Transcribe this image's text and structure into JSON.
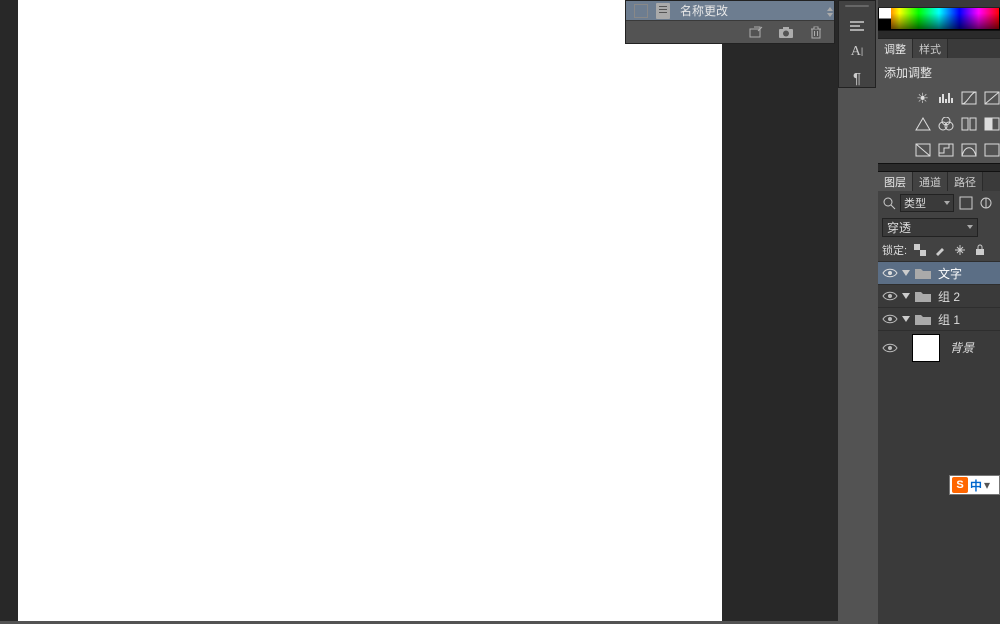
{
  "notes_panel": {
    "filename_label": "名称更改"
  },
  "icon_strip": {
    "lines": "align-lines-icon",
    "type": "A|",
    "paragraph": "¶"
  },
  "adjustments": {
    "tabs": [
      "调整",
      "样式"
    ],
    "title": "添加调整"
  },
  "layers": {
    "tabs": [
      "图层",
      "通道",
      "路径"
    ],
    "filter_label": "类型",
    "blend_mode": "穿透",
    "lock_label": "锁定:",
    "items": [
      {
        "name": "文字",
        "type": "folder",
        "selected": true
      },
      {
        "name": "组 2",
        "type": "folder",
        "selected": false
      },
      {
        "name": "组 1",
        "type": "folder",
        "selected": false
      },
      {
        "name": "背景",
        "type": "background",
        "selected": false
      }
    ]
  },
  "ime": {
    "logo": "S",
    "lang": "中",
    "drop": "▾"
  }
}
